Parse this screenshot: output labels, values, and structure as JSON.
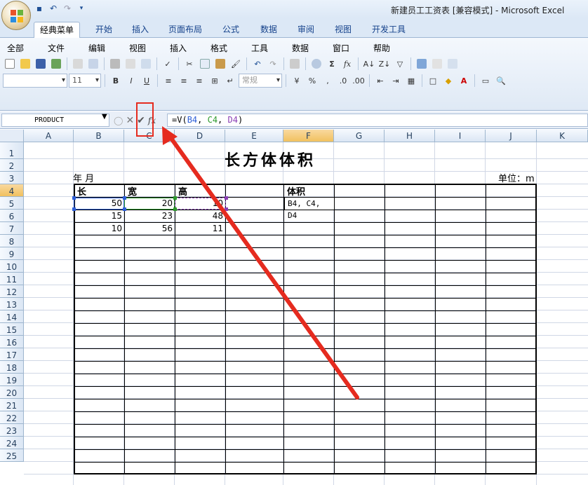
{
  "window": {
    "title": "新建员工工资表  [兼容模式] - Microsoft Excel"
  },
  "tabs": [
    "经典菜单",
    "开始",
    "插入",
    "页面布局",
    "公式",
    "数据",
    "审阅",
    "视图",
    "开发工具"
  ],
  "menus": [
    "全部",
    "文件",
    "编辑",
    "视图",
    "插入",
    "格式",
    "工具",
    "数据",
    "窗口",
    "帮助"
  ],
  "toolbar": {
    "font_size": "11",
    "number_format": "常规"
  },
  "formula_bar": {
    "name_box": "PRODUCT",
    "fx_label": "fx",
    "formula_prefix": "=V(",
    "ref_b4": "B4",
    "ref_c4": "C4",
    "ref_d4": "D4",
    "formula_close": ")"
  },
  "columns": [
    "A",
    "B",
    "C",
    "D",
    "E",
    "F",
    "G",
    "H",
    "I",
    "J",
    "K"
  ],
  "rows": [
    "1",
    "2",
    "3",
    "4",
    "5",
    "6",
    "7",
    "8",
    "9",
    "10",
    "11",
    "12",
    "13",
    "14",
    "15",
    "16",
    "17",
    "18",
    "19",
    "20",
    "21",
    "22",
    "23",
    "24",
    "25"
  ],
  "sheet": {
    "title": "长方体体积",
    "year_month": "年    月",
    "unit": "单位：m",
    "headers": {
      "length": "长",
      "width": "宽",
      "height": "高",
      "volume": "体积"
    },
    "data": [
      {
        "length": "50",
        "width": "20",
        "height": "10"
      },
      {
        "length": "15",
        "width": "23",
        "height": "48"
      },
      {
        "length": "10",
        "width": "56",
        "height": "11"
      }
    ],
    "f4_editing": "B4, C4, D4"
  },
  "colors": {
    "highlight": "#e52b1f",
    "ref_b4": "#2e5fd8",
    "ref_c4": "#2e9a2e",
    "ref_d4": "#8b3fb5"
  }
}
